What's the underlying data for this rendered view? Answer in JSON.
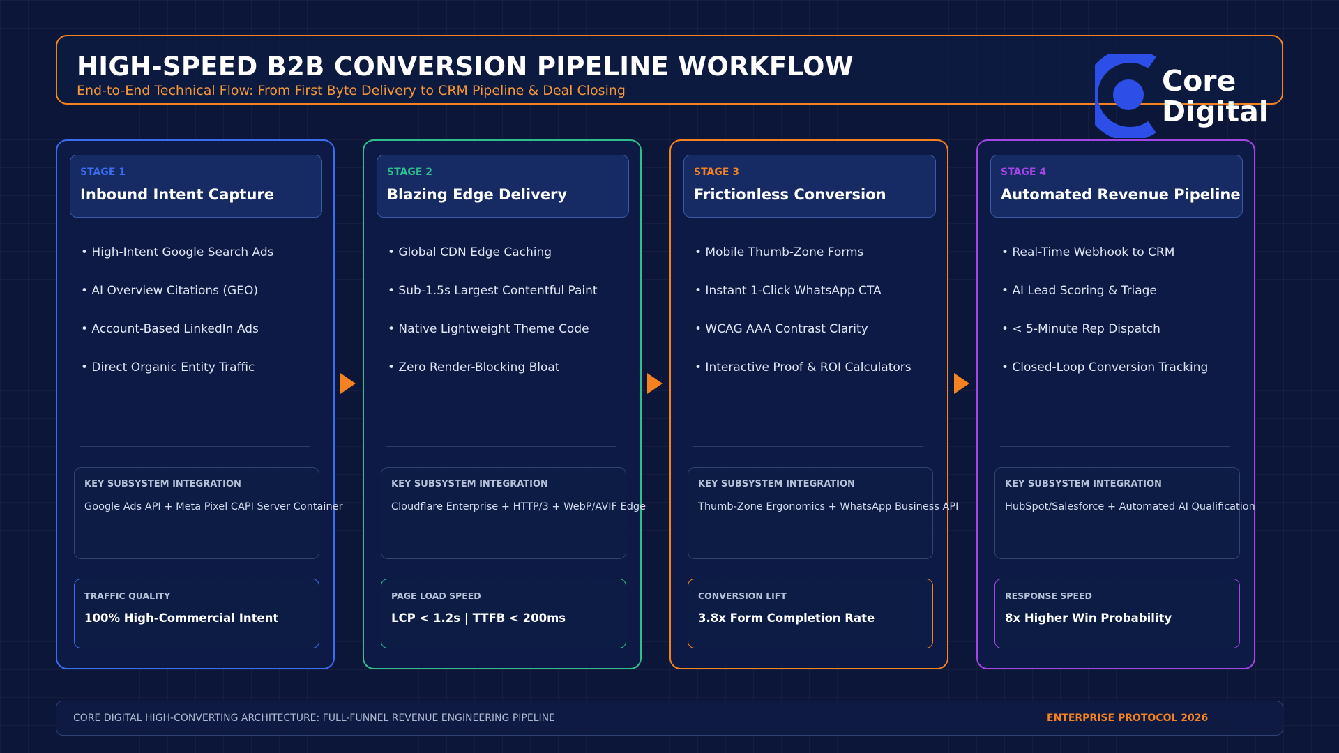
{
  "header": {
    "title": "HIGH-SPEED B2B CONVERSION PIPELINE WORKFLOW",
    "subtitle": "End-to-End Technical Flow: From First Byte Delivery to CRM Pipeline & Deal Closing"
  },
  "logo": {
    "line1": "Core",
    "line2": "Digital",
    "icon": "core-digital-logo-icon",
    "color": "#2d4fe8"
  },
  "stages": [
    {
      "number": "STAGE 1",
      "title": "Inbound Intent Capture",
      "accent": "#3b6df0",
      "features": [
        "• High-Intent Google Search Ads",
        "• AI Overview Citations (GEO)",
        "• Account-Based LinkedIn Ads",
        "• Direct Organic Entity Traffic"
      ],
      "integration_label": "KEY SUBSYSTEM INTEGRATION",
      "integration_text": "Google Ads API + Meta Pixel CAPI Server Container",
      "metric_label": "TRAFFIC QUALITY",
      "metric_value": "100% High-Commercial Intent"
    },
    {
      "number": "STAGE 2",
      "title": "Blazing Edge Delivery",
      "accent": "#2ebf8c",
      "features": [
        "• Global CDN Edge Caching",
        "• Sub-1.5s Largest Contentful Paint",
        "• Native Lightweight Theme Code",
        "• Zero Render-Blocking Bloat"
      ],
      "integration_label": "KEY SUBSYSTEM INTEGRATION",
      "integration_text": "Cloudflare Enterprise + HTTP/3 + WebP/AVIF Edge",
      "metric_label": "PAGE LOAD SPEED",
      "metric_value": "LCP < 1.2s | TTFB < 200ms"
    },
    {
      "number": "STAGE 3",
      "title": "Frictionless Conversion",
      "accent": "#f58220",
      "features": [
        "• Mobile Thumb-Zone Forms",
        "• Instant 1-Click WhatsApp CTA",
        "• WCAG AAA Contrast Clarity",
        "• Interactive Proof & ROI Calculators"
      ],
      "integration_label": "KEY SUBSYSTEM INTEGRATION",
      "integration_text": "Thumb-Zone Ergonomics + WhatsApp Business API",
      "metric_label": "CONVERSION LIFT",
      "metric_value": "3.8x Form Completion Rate"
    },
    {
      "number": "STAGE 4",
      "title": "Automated Revenue Pipeline",
      "accent": "#a445e8",
      "features": [
        "• Real-Time Webhook to CRM",
        "• AI Lead Scoring & Triage",
        "• < 5-Minute Rep Dispatch",
        "• Closed-Loop Conversion Tracking"
      ],
      "integration_label": "KEY SUBSYSTEM INTEGRATION",
      "integration_text": "HubSpot/Salesforce + Automated AI Qualification",
      "metric_label": "RESPONSE SPEED",
      "metric_value": "8x Higher Win Probability"
    }
  ],
  "footer": {
    "left": "CORE DIGITAL HIGH-CONVERTING ARCHITECTURE: FULL-FUNNEL REVENUE ENGINEERING PIPELINE",
    "right": "ENTERPRISE PROTOCOL 2026"
  },
  "colors": {
    "background": "#0c1638",
    "header_border": "#f58220",
    "arrow": "#f58220"
  }
}
